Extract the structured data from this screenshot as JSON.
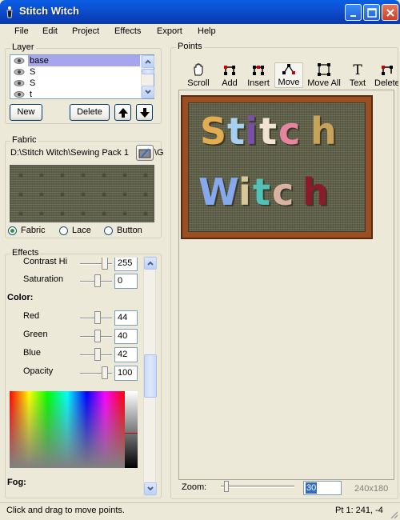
{
  "window": {
    "title": "Stitch Witch",
    "controls": [
      "minimize",
      "maximize",
      "close"
    ]
  },
  "menu": [
    "File",
    "Edit",
    "Project",
    "Effects",
    "Export",
    "Help"
  ],
  "layer": {
    "group_label": "Layer",
    "items": [
      {
        "label": "base",
        "selected": true
      },
      {
        "label": "S",
        "selected": false
      },
      {
        "label": "S",
        "selected": false
      },
      {
        "label": "t",
        "selected": false
      }
    ],
    "new_label": "New",
    "delete_label": "Delete"
  },
  "fabric": {
    "group_label": "Fabric",
    "path": "D:\\Stitch Witch\\Sewing Pack 1",
    "path_overflow": "\\G",
    "options": [
      "Fabric",
      "Lace",
      "Button"
    ],
    "selected_option": "Fabric"
  },
  "effects": {
    "group_label": "Effects",
    "contrast": {
      "label": "Contrast Hi",
      "value": "255"
    },
    "saturation": {
      "label": "Saturation",
      "value": "0"
    },
    "color_heading": "Color:",
    "red": {
      "label": "Red",
      "value": "44"
    },
    "green": {
      "label": "Green",
      "value": "40"
    },
    "blue": {
      "label": "Blue",
      "value": "42"
    },
    "opacity": {
      "label": "Opacity",
      "value": "100"
    },
    "fog_heading": "Fog:"
  },
  "points": {
    "group_label": "Points",
    "tools": [
      {
        "label": "Scroll",
        "icon": "hand-icon"
      },
      {
        "label": "Add",
        "icon": "add-points-icon"
      },
      {
        "label": "Insert",
        "icon": "insert-points-icon"
      },
      {
        "label": "Move",
        "icon": "move-points-icon",
        "active": true
      },
      {
        "label": "Move All",
        "icon": "move-all-icon"
      },
      {
        "label": "Text",
        "icon": "text-icon"
      },
      {
        "label": "Delete",
        "icon": "delete-points-icon"
      }
    ],
    "canvas_word_1": "Stitch",
    "canvas_word_2": "Witch",
    "zoom_label": "Zoom:",
    "zoom_value": "30",
    "canvas_size": "240x180"
  },
  "colors": {
    "titlebar": "#0a4fd0",
    "selection": "#a6a6ee",
    "frame": "#9a4e22",
    "fabric": "#5f6049"
  },
  "status": {
    "message": "Click and drag to move points.",
    "position": "Pt 1: 241, -4"
  }
}
